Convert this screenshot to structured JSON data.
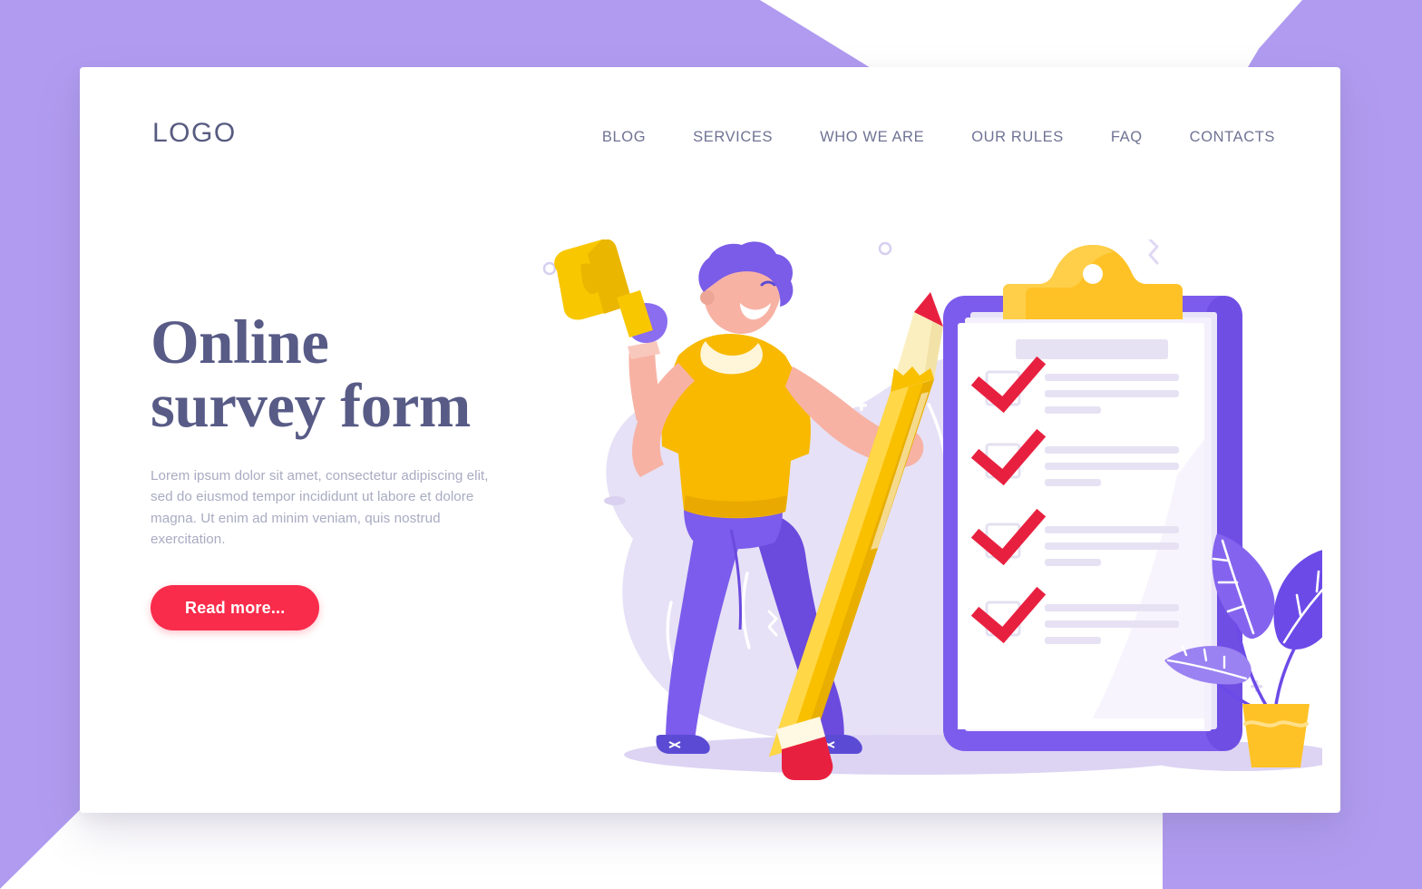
{
  "background": {
    "purple": "#b09bf0",
    "white": "#ffffff",
    "card_bg": "#ffffff"
  },
  "header": {
    "logo": "LOGO",
    "nav": [
      {
        "label": "BLOG",
        "name": "nav-item-blog"
      },
      {
        "label": "SERVICES",
        "name": "nav-item-services"
      },
      {
        "label": "WHO WE ARE",
        "name": "nav-item-who-we-are"
      },
      {
        "label": "OUR RULES",
        "name": "nav-item-our-rules"
      },
      {
        "label": "FAQ",
        "name": "nav-item-faq"
      },
      {
        "label": "CONTACTS",
        "name": "nav-item-contacts"
      }
    ]
  },
  "hero": {
    "title_line1": "Online",
    "title_line2": "survey form",
    "title_color": "#585b86",
    "paragraph": "Lorem ipsum dolor sit amet, consectetur adipiscing elit, sed do eiusmod tempor incididunt ut labore et dolore magna. Ut enim ad minim veniam, quis nostrud exercitation.",
    "cta_label": "Read more...",
    "cta_color": "#f92c4b"
  },
  "illustration": {
    "blob_color": "#e4dff5",
    "ground_color": "#ddd5f3",
    "clipboard": {
      "frame_color": "#7c5cec",
      "frame_shadow": "#6a4ad8",
      "clip_color": "#ffc226",
      "clip_highlight": "#ffd24b",
      "paper_color": "#ffffff",
      "paper_stack_color": "#efeaf9",
      "line_color": "#e6e2f2",
      "checkbox_border": "#e2def0",
      "check_color": "#e8203f",
      "rows": 4,
      "lines_per_row": 3
    },
    "character": {
      "skin": "#f7b2a4",
      "skin_shade": "#eda596",
      "hair": "#7a5ce8",
      "shirt": "#f8b900",
      "shirt_shade": "#eaa900",
      "collar": "#fff6d9",
      "pants": "#7c5cec",
      "pants_shade": "#6b4ade",
      "shoes": "#5b4bd4",
      "megaphone": "#f8c700",
      "megaphone_shade": "#eab600",
      "wristband": "#8b6df0"
    },
    "pencil": {
      "body": "#f9c000",
      "body_shade": "#e8ae00",
      "body_light": "#ffd747",
      "wood": "#fbefc0",
      "tip": "#e8203f",
      "ferrule": "#fff8e3",
      "eraser": "#e8203f"
    },
    "plant": {
      "leaf_dark": "#6c4ae8",
      "leaf_mid": "#8464ee",
      "leaf_light": "#9b82f2",
      "vein": "#ffffff",
      "pot": "#ffc226",
      "pot_band": "#ffe08a"
    },
    "decor_color": "#ffffff",
    "decor_ring_color": "#d7cff0"
  }
}
